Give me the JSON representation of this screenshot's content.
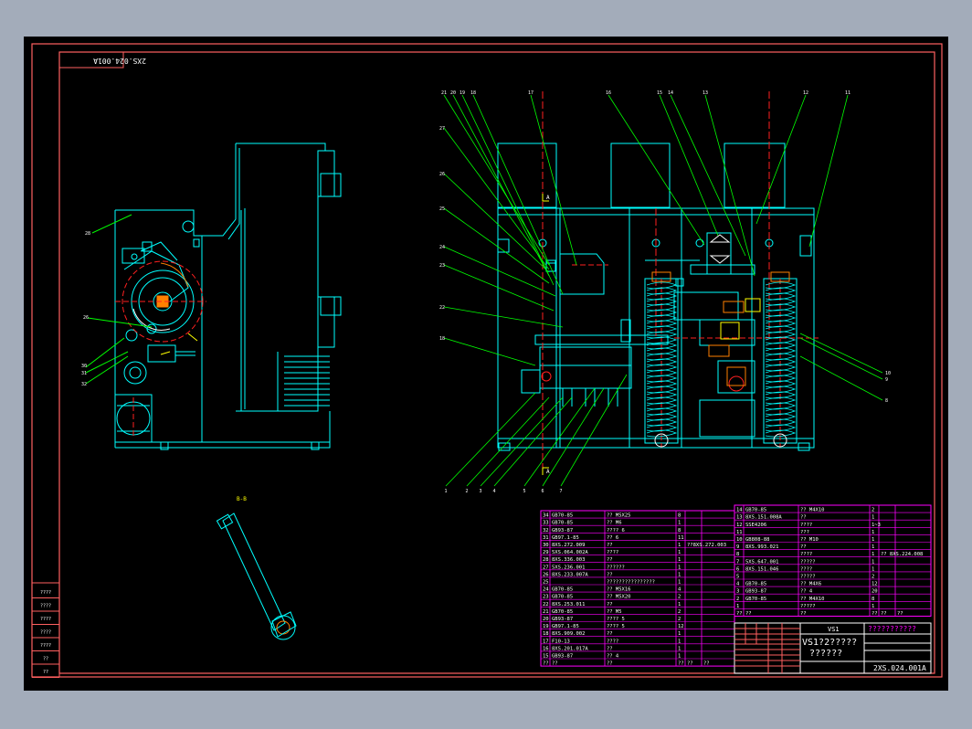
{
  "drawing": {
    "drawing_number": "2XS.024.001A",
    "stamp_mirrored": "2XS.024.001A",
    "title_model": "VS1",
    "title_name_line1": "VS1?2?????",
    "title_name_line2": "??????",
    "title_company": "???????????",
    "handle_label": "B-B",
    "label_A_top": "A",
    "label_A_bottom": "A"
  },
  "colors": {
    "frame": "#ff6060",
    "outline": "#00ffff",
    "leader": "#00ff00",
    "table": "#ff00ff",
    "text": "#ffffff",
    "yellow": "#ffff00",
    "center": "#ff2020"
  },
  "left_stamp_rows": [
    "????",
    "????",
    "????",
    "????",
    "????",
    "??",
    "??"
  ],
  "bom_left": [
    [
      "34",
      "GB70-85",
      "?? M5X25",
      "8",
      ""
    ],
    [
      "33",
      "GB70-85",
      "?? M6",
      "1",
      ""
    ],
    [
      "32",
      "GB93-87",
      "????  6",
      "8",
      ""
    ],
    [
      "31",
      "GB97.1-85",
      "??  6",
      "11",
      ""
    ],
    [
      "30",
      "8XS.272.009",
      "??",
      "1",
      "??8XS.272.003"
    ],
    [
      "29",
      "5XS.064.002A",
      "????",
      "1",
      ""
    ],
    [
      "28",
      "8XS.336.003",
      "??",
      "1",
      ""
    ],
    [
      "27",
      "5XS.236.001",
      "??????",
      "1",
      ""
    ],
    [
      "26",
      "8XS.233.007A",
      "??",
      "1",
      ""
    ],
    [
      "25",
      "",
      "????????????????",
      "1",
      ""
    ],
    [
      "24",
      "GB70-85",
      "??  M5X16",
      "4",
      ""
    ],
    [
      "23",
      "GB70-85",
      "??  M5X20",
      "2",
      ""
    ],
    [
      "22",
      "8XS.253.011",
      "??",
      "1",
      ""
    ],
    [
      "21",
      "GB70-85",
      "??  M5",
      "2",
      ""
    ],
    [
      "20",
      "GB93-87",
      "????  5",
      "2",
      ""
    ],
    [
      "19",
      "GB97.1-85",
      "????  5",
      "12",
      ""
    ],
    [
      "18",
      "8XS.909.002",
      "??",
      "1",
      ""
    ],
    [
      "17",
      "F10-13",
      "????",
      "1",
      ""
    ],
    [
      "16",
      "8XS.201.017A",
      "??",
      "1",
      ""
    ],
    [
      "15",
      "GB93-87",
      "??  4",
      "1",
      ""
    ]
  ],
  "bom_left_header": [
    "??",
    "??",
    "??",
    "??",
    "??",
    "??"
  ],
  "bom_right": [
    [
      "14",
      "GB70-85",
      "??  M4X10",
      "2",
      ""
    ],
    [
      "13",
      "8XS.151.008A",
      "??",
      "1",
      ""
    ],
    [
      "12",
      "SSE4206",
      "????",
      "1~3",
      ""
    ],
    [
      "11",
      "",
      "???",
      "1",
      ""
    ],
    [
      "10",
      "GB808-88",
      "??  M10",
      "1",
      ""
    ],
    [
      "9",
      "8XS.993.021",
      "??",
      "1",
      ""
    ],
    [
      "8",
      "",
      "????",
      "1",
      "??  8XS.224.008"
    ],
    [
      "7",
      "5XS.647.001",
      "?????",
      "1",
      ""
    ],
    [
      "6",
      "8XS.151.046",
      "????",
      "1",
      ""
    ],
    [
      "5",
      "",
      "?????",
      "2",
      ""
    ],
    [
      "4",
      "GB70-85",
      "??  M4X6",
      "12",
      ""
    ],
    [
      "3",
      "GB93-87",
      "??  4",
      "20",
      ""
    ],
    [
      "2",
      "GB70-85",
      "??  M4X10",
      "8",
      ""
    ],
    [
      "1",
      "",
      "?????",
      "1",
      ""
    ]
  ],
  "bom_right_header": [
    "??",
    "??",
    "??",
    "??",
    "??",
    "??"
  ],
  "left_callouts": [
    "28",
    "26",
    "30",
    "31",
    "32"
  ],
  "top_callouts": [
    "21",
    "20",
    "19",
    "18",
    "17",
    "16",
    "15",
    "14",
    "13",
    "12",
    "11"
  ],
  "left_side_callouts": [
    "27",
    "26",
    "25",
    "24",
    "23",
    "22",
    "18"
  ],
  "bottom_callouts": [
    "1",
    "2",
    "3",
    "4",
    "5",
    "6",
    "7"
  ],
  "right_callouts": [
    "10",
    "9",
    "8"
  ],
  "title_small": [
    "??",
    "??",
    "??",
    "??",
    "??",
    "??",
    "??"
  ]
}
